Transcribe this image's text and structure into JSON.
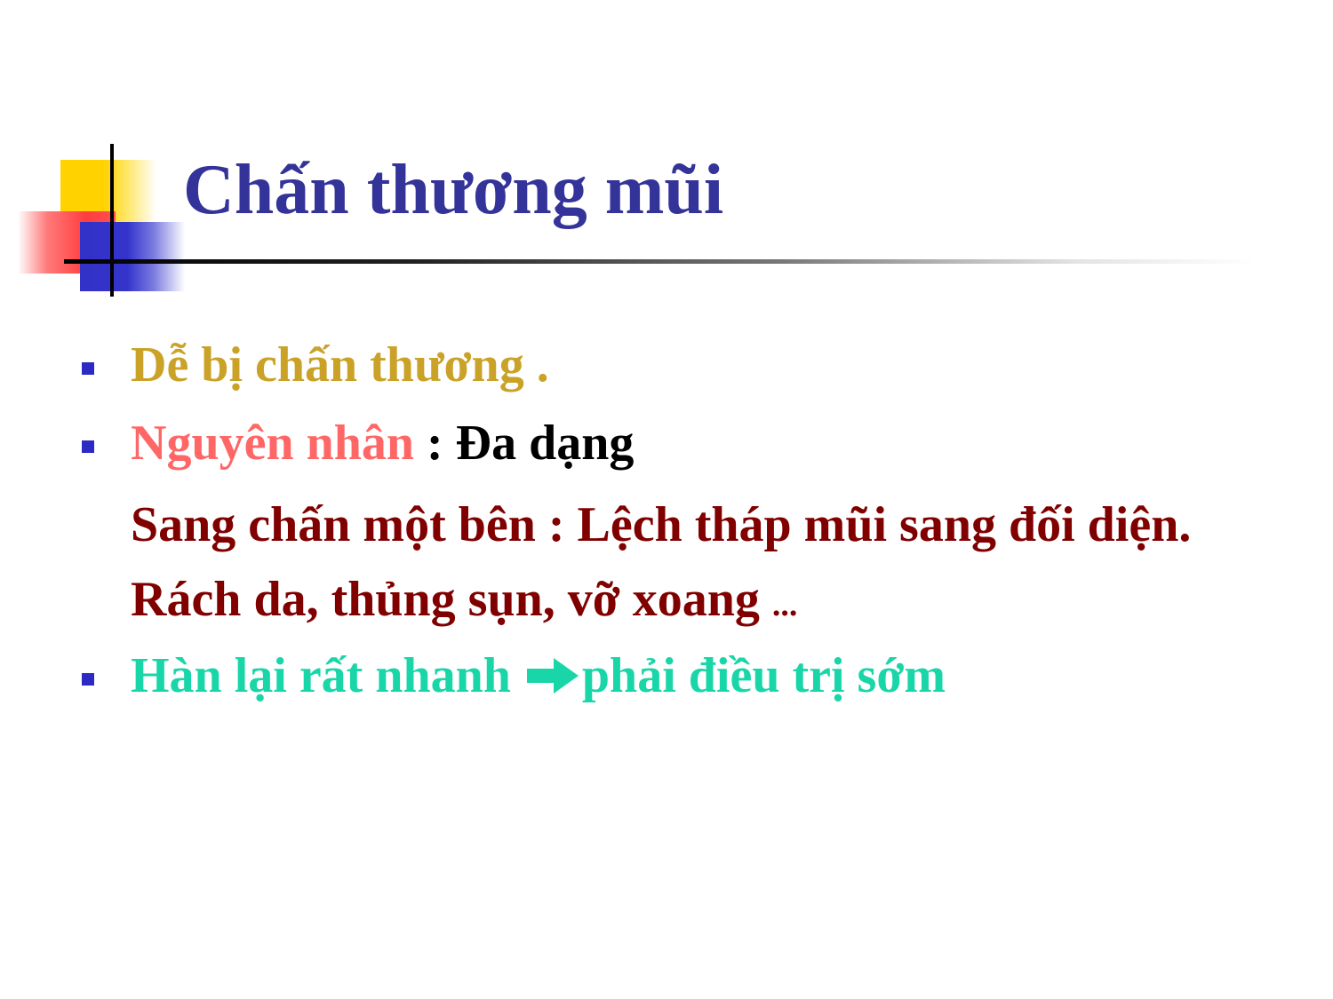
{
  "slide": {
    "title": "Chấn thương mũi",
    "bullets": {
      "b1": "Dễ bị chấn thương .",
      "b2_label": "Nguyên nhân",
      "b2_value": " : Đa dạng",
      "p1": "Sang chấn một bên : Lệch tháp mũi sang đối diện.",
      "p2_text": "Rách da, thủng sụn, vỡ xoang ",
      "p2_ellipsis": "...",
      "b3_left": "Hàn lại rất nhanh ",
      "b3_right": "phải điều trị sớm"
    }
  },
  "colors": {
    "title": "#333399",
    "bullet_marker": "#2b2bc4",
    "line1": "#c9a227",
    "cause_label": "#ff6666",
    "detail": "#800000",
    "conclusion": "#19d6a8"
  },
  "icons": {
    "bullet": "square-bullet-icon",
    "arrow": "right-arrow-icon"
  }
}
